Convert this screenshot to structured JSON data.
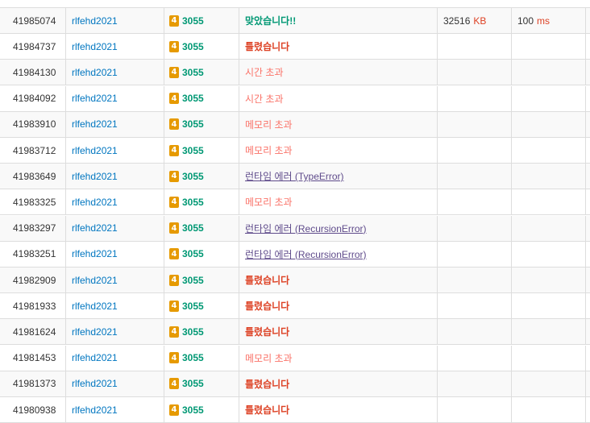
{
  "submissions": [
    {
      "id": "41985074",
      "user": "rlfehd2021",
      "tier": "4",
      "problem": "3055",
      "result": "맞았습니다!!",
      "result_type": "ac",
      "memory": "32516",
      "memory_unit": "KB",
      "time": "100",
      "time_unit": "ms"
    },
    {
      "id": "41984737",
      "user": "rlfehd2021",
      "tier": "4",
      "problem": "3055",
      "result": "틀렸습니다",
      "result_type": "wa"
    },
    {
      "id": "41984130",
      "user": "rlfehd2021",
      "tier": "4",
      "problem": "3055",
      "result": "시간 초과",
      "result_type": "tle"
    },
    {
      "id": "41984092",
      "user": "rlfehd2021",
      "tier": "4",
      "problem": "3055",
      "result": "시간 초과",
      "result_type": "tle"
    },
    {
      "id": "41983910",
      "user": "rlfehd2021",
      "tier": "4",
      "problem": "3055",
      "result": "메모리 초과",
      "result_type": "mle"
    },
    {
      "id": "41983712",
      "user": "rlfehd2021",
      "tier": "4",
      "problem": "3055",
      "result": "메모리 초과",
      "result_type": "mle"
    },
    {
      "id": "41983649",
      "user": "rlfehd2021",
      "tier": "4",
      "problem": "3055",
      "result": "런타임 에러 (TypeError)",
      "result_type": "rte"
    },
    {
      "id": "41983325",
      "user": "rlfehd2021",
      "tier": "4",
      "problem": "3055",
      "result": "메모리 초과",
      "result_type": "mle"
    },
    {
      "id": "41983297",
      "user": "rlfehd2021",
      "tier": "4",
      "problem": "3055",
      "result": "런타임 에러 (RecursionError)",
      "result_type": "rte"
    },
    {
      "id": "41983251",
      "user": "rlfehd2021",
      "tier": "4",
      "problem": "3055",
      "result": "런타임 에러 (RecursionError)",
      "result_type": "rte"
    },
    {
      "id": "41982909",
      "user": "rlfehd2021",
      "tier": "4",
      "problem": "3055",
      "result": "틀렸습니다",
      "result_type": "wa"
    },
    {
      "id": "41981933",
      "user": "rlfehd2021",
      "tier": "4",
      "problem": "3055",
      "result": "틀렸습니다",
      "result_type": "wa"
    },
    {
      "id": "41981624",
      "user": "rlfehd2021",
      "tier": "4",
      "problem": "3055",
      "result": "틀렸습니다",
      "result_type": "wa"
    },
    {
      "id": "41981453",
      "user": "rlfehd2021",
      "tier": "4",
      "problem": "3055",
      "result": "메모리 초과",
      "result_type": "mle"
    },
    {
      "id": "41981373",
      "user": "rlfehd2021",
      "tier": "4",
      "problem": "3055",
      "result": "틀렸습니다",
      "result_type": "wa"
    },
    {
      "id": "41980938",
      "user": "rlfehd2021",
      "tier": "4",
      "problem": "3055",
      "result": "틀렸습니다",
      "result_type": "wa"
    }
  ],
  "colors": {
    "accepted": "#009874",
    "wrong": "#dd4124",
    "time_limit": "#fa7268",
    "memory_limit": "#fa7268",
    "runtime_error": "#5f4b8b",
    "user_link": "#0076c0",
    "tier_badge": "#e69a00"
  }
}
